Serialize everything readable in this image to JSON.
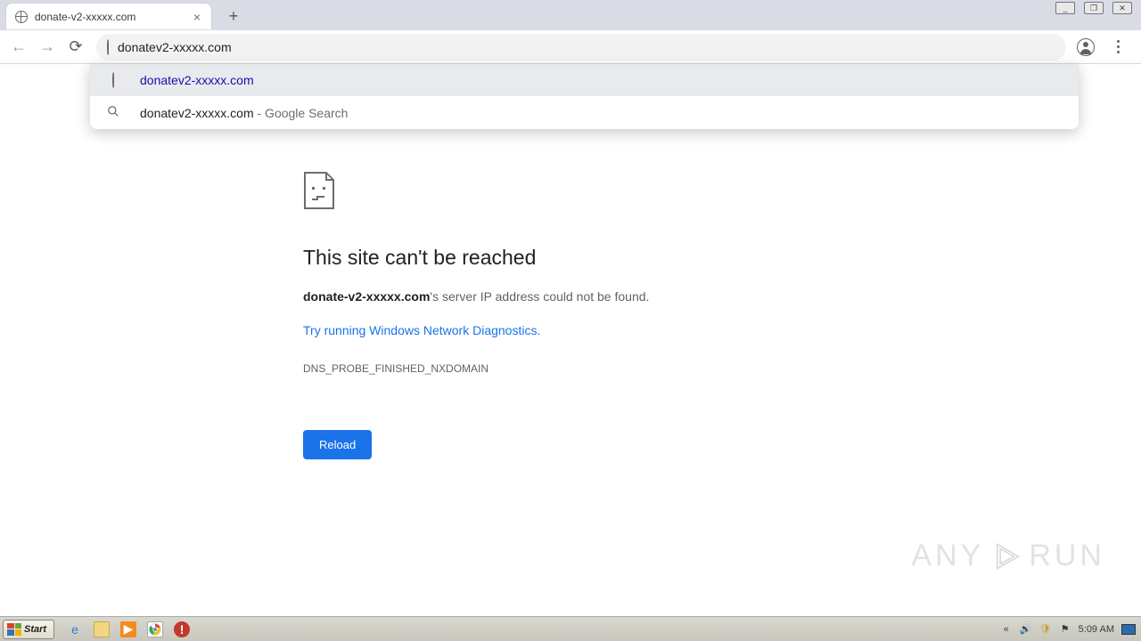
{
  "window_controls": {
    "min": "_",
    "max": "❐",
    "close": "✕"
  },
  "tab": {
    "title": "donate-v2-xxxxx.com"
  },
  "toolbar": {
    "url": "donatev2-xxxxx.com"
  },
  "suggestions": [
    {
      "type": "site",
      "text": "donatev2-xxxxx.com"
    },
    {
      "type": "search",
      "text": "donatev2-xxxxx.com",
      "rest": " - Google Search"
    }
  ],
  "error": {
    "title": "This site can't be reached",
    "host": "donate-v2-xxxxx.com",
    "host_suffix": "'s server IP address could not be found.",
    "diag_link": "Try running Windows Network Diagnostics.",
    "code": "DNS_PROBE_FINISHED_NXDOMAIN",
    "reload": "Reload"
  },
  "watermark": {
    "left": "ANY",
    "right": "RUN"
  },
  "taskbar": {
    "start": "Start",
    "clock": "5:09 AM"
  }
}
